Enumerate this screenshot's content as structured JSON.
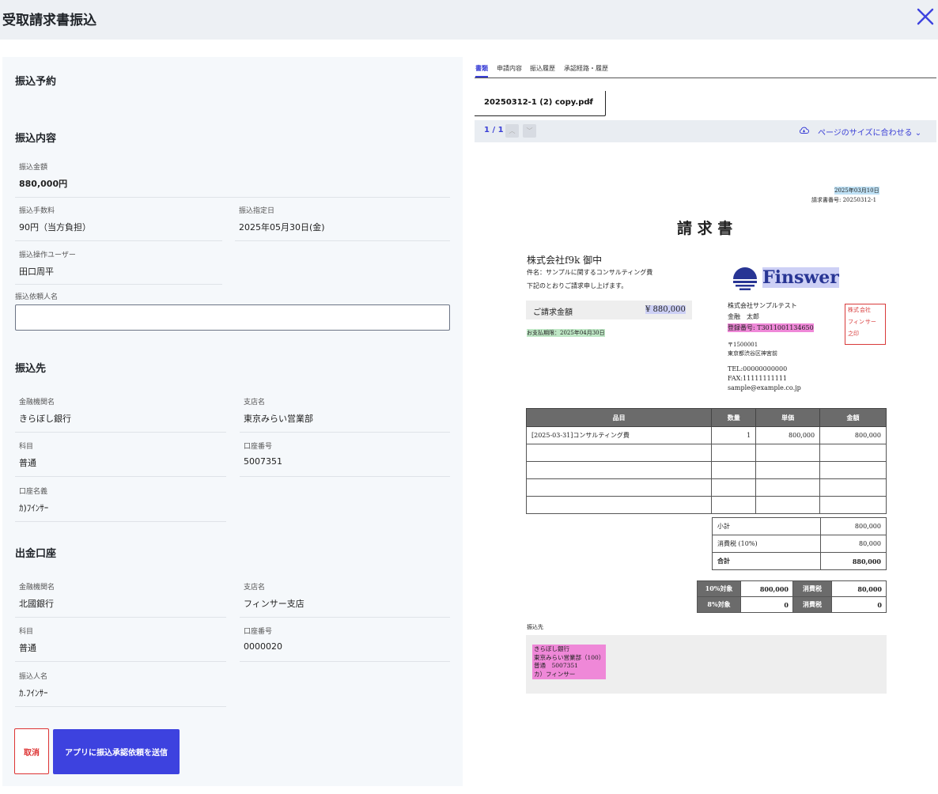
{
  "header": {
    "title": "受取請求書振込"
  },
  "form": {
    "section_reservation": "振込予約",
    "section_content": "振込内容",
    "amount": {
      "label": "振込金額",
      "value": "880,000円"
    },
    "fee": {
      "label": "振込手数料",
      "value": "90円（当方負担）"
    },
    "date": {
      "label": "振込指定日",
      "value": "2025年05月30日(金)"
    },
    "operator": {
      "label": "振込操作ユーザー",
      "value": "田口周平"
    },
    "requester": {
      "label": "振込依頼人名",
      "value": ""
    },
    "section_payee": "振込先",
    "payee": {
      "bank_label": "金融機関名",
      "bank": "きらぼし銀行",
      "branch_label": "支店名",
      "branch": "東京みらい営業部",
      "type_label": "科目",
      "type": "普通",
      "number_label": "口座番号",
      "number": "5007351",
      "holder_label": "口座名義",
      "holder": "ｶ)ﾌｲﾝｻｰ"
    },
    "section_source": "出金口座",
    "source": {
      "bank_label": "金融機関名",
      "bank": "北國銀行",
      "branch_label": "支店名",
      "branch": "フィンサー支店",
      "type_label": "科目",
      "type": "普通",
      "number_label": "口座番号",
      "number": "0000020",
      "holder_label": "振込人名",
      "holder": "ｶ.ﾌｲﾝｻｰ"
    },
    "cancel_label": "取消",
    "send_label": "アプリに振込承認依頼を送信"
  },
  "viewer": {
    "tabs": [
      "書類",
      "申請内容",
      "振込履歴",
      "承認経路・履歴"
    ],
    "file_name": "20250312-1 (2) copy.pdf",
    "page_indicator": "1 / 1",
    "zoom_label": "ページのサイズに合わせる",
    "colors": {
      "accent": "#3d42df"
    }
  },
  "invoice": {
    "date": "2025年03月10日",
    "number": "請求書番号: 20250312-1",
    "title": "請 求 書",
    "client": "株式会社f9k 御中",
    "subject": "件名：サンプルに関するコンサルティング費",
    "intro": "下記のとおりご請求申し上げます。",
    "amount_label": "ご請求金額",
    "amount": "¥ 880,000",
    "due": "お支払期限：2025年04月30日",
    "logo_text": "Finswer",
    "company": "株式会社サンプルテスト",
    "person": "金融　太郎",
    "reg_no": "登録番号: T3011001134650",
    "postal": "〒1500001",
    "address": "東京都渋谷区神宮前",
    "tel": "TEL:00000000000",
    "fax": "FAX:11111111111",
    "email": "sample@example.co.jp",
    "seal_text": [
      "株式",
      "会社",
      "フィン",
      "サー",
      "之印"
    ],
    "table_headers": [
      "品目",
      "数量",
      "単価",
      "金額"
    ],
    "table_row": {
      "item": "[2025-03-31]コンサルティング費",
      "qty": "1",
      "price": "800,000",
      "amount": "800,000"
    },
    "subtotal_label": "小計",
    "subtotal": "800,000",
    "tax_label": "消費税 (10%)",
    "tax": "80,000",
    "total_label": "合計",
    "total": "880,000",
    "tax10_label": "10%対象",
    "tax10_base": "800,000",
    "tax10_tax_label": "消費税",
    "tax10_tax": "80,000",
    "tax8_label": "8%対象",
    "tax8_base": "0",
    "tax8_tax_label": "消費税",
    "tax8_tax": "0",
    "bank_title": "振込先",
    "bank_lines": [
      "きらぼし銀行",
      "東京みらい営業部（100）",
      "普通　5007351",
      "カ）フィンサー"
    ]
  }
}
